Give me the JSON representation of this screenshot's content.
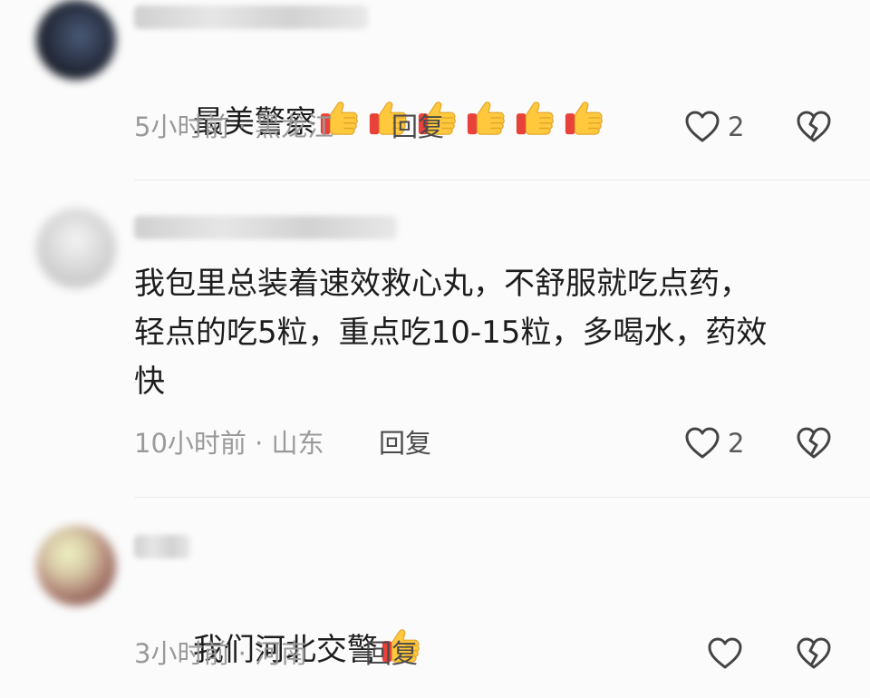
{
  "comments": [
    {
      "text": "最美警察",
      "thumbs_count": 6,
      "meta": "5小时前 · 黑龙江",
      "reply": "回复",
      "likes": "2"
    },
    {
      "text": "我包里总装着速效救心丸，不舒服就吃点药，\n轻点的吃5粒，重点吃10-15粒，多喝水，药效\n快",
      "meta": "10小时前 · 山东",
      "reply": "回复",
      "likes": "2"
    },
    {
      "text": "我们河北交警",
      "thumbs_count": 1,
      "meta": "3小时前 · 河南",
      "reply": "回复",
      "likes": ""
    }
  ],
  "icons": {
    "like": "heart-outline-icon",
    "dislike": "broken-heart-icon",
    "emoji": "thumbs-up-emoji"
  }
}
